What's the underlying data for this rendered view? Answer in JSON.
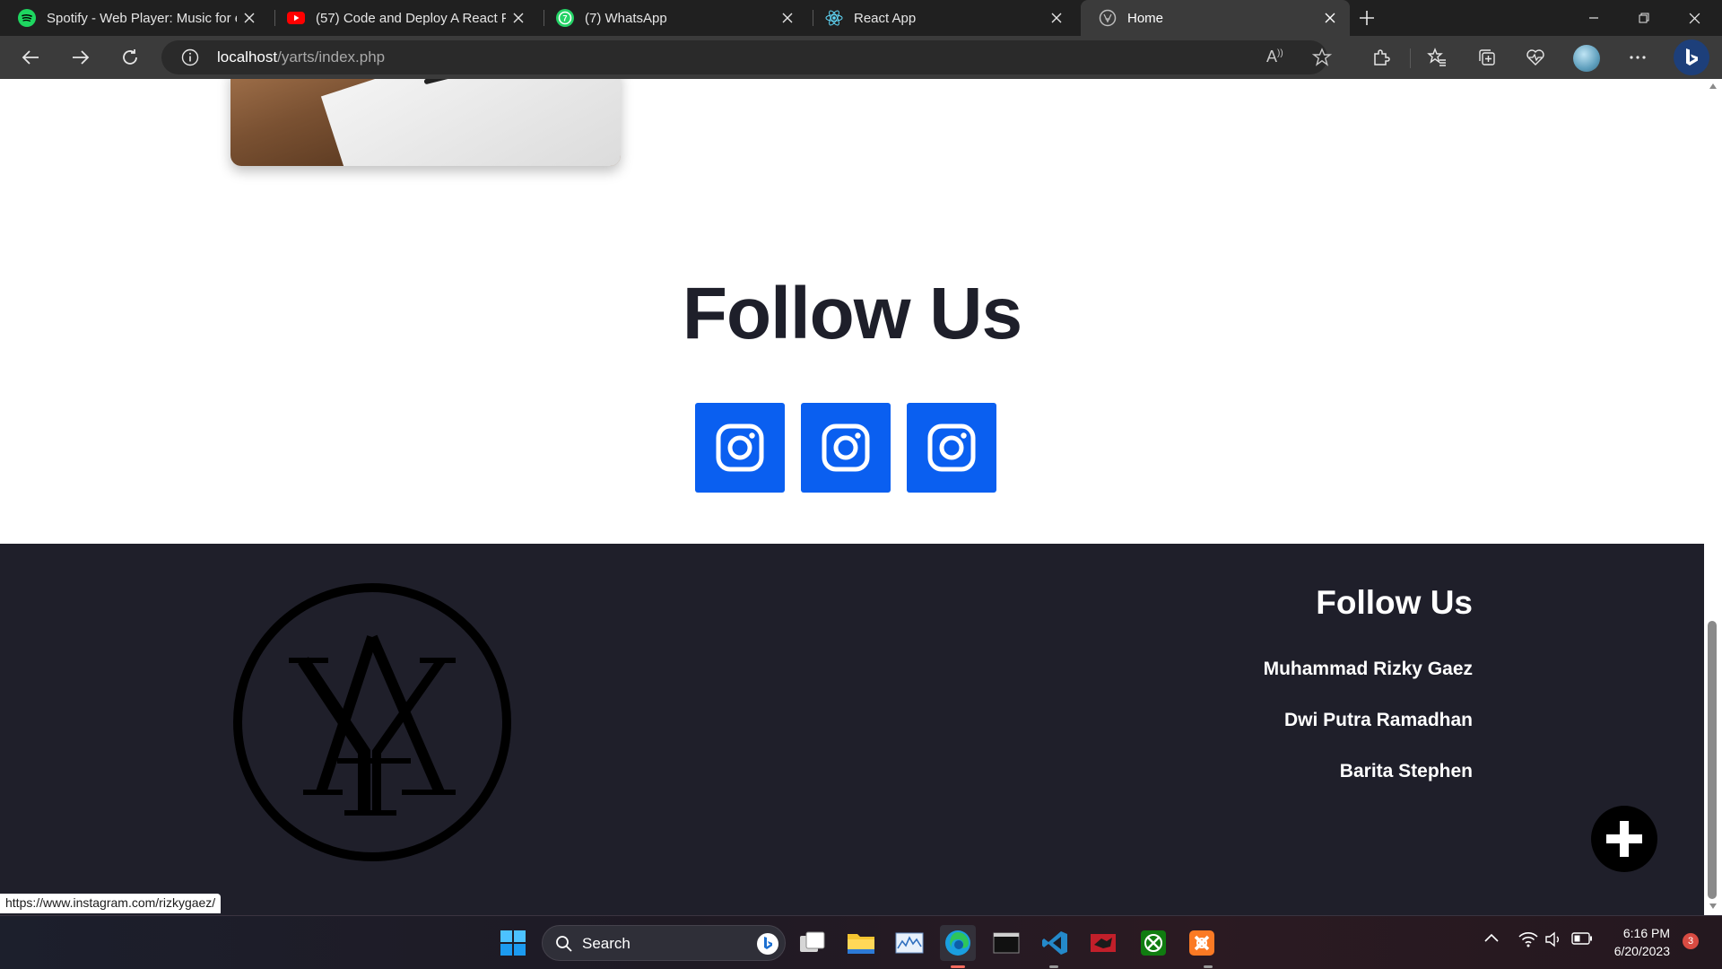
{
  "browser": {
    "tabs": [
      {
        "title": "Spotify - Web Player: Music for e",
        "icon": "spotify-icon",
        "active": false
      },
      {
        "title": "(57) Code and Deploy A React Po",
        "icon": "youtube-icon",
        "active": false
      },
      {
        "title": "(7) WhatsApp",
        "icon": "whatsapp-icon",
        "active": false
      },
      {
        "title": "React App",
        "icon": "react-icon",
        "active": false
      },
      {
        "title": "Home",
        "icon": "site-icon",
        "active": true
      }
    ],
    "url_host": "localhost",
    "url_path": "/yarts/index.php",
    "read_aloud_label": "A",
    "status_url": "https://www.instagram.com/rizkygaez/"
  },
  "page": {
    "follow_title": "Follow Us",
    "social_buttons": [
      "instagram-icon",
      "instagram-icon",
      "instagram-icon"
    ],
    "footer": {
      "title": "Follow Us",
      "links": [
        "Muhammad Rizky Gaez",
        "Dwi Putra Ramadhan",
        "Barita Stephen"
      ],
      "logo_text": "YA"
    }
  },
  "taskbar": {
    "search_label": "Search",
    "time": "6:16 PM",
    "date": "6/20/2023",
    "notification_count": "3"
  },
  "colors": {
    "accent_blue": "#0a5ff0",
    "footer_bg": "#1f1f2a",
    "title_dark": "#1e1f2a"
  }
}
